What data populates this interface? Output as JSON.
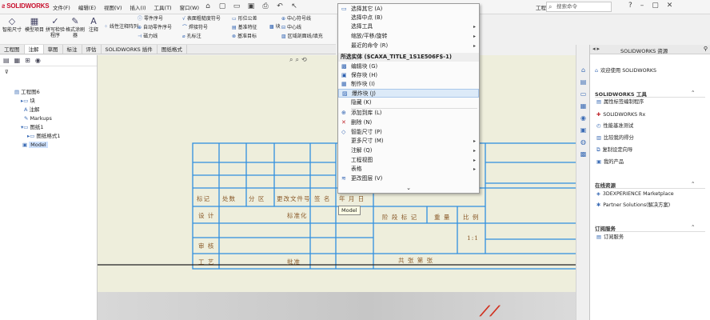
{
  "app": {
    "logo": "SOLIDWORKS",
    "menus": [
      "文件(F)",
      "编辑(E)",
      "视图(V)",
      "插入(I)",
      "工具(T)",
      "窗口(W)"
    ],
    "doc_title": "工程图6...",
    "search_placeholder": "搜索命令"
  },
  "ribbon": {
    "big_buttons": [
      {
        "label": "智能尺寸",
        "icon": "smart-dimension-icon"
      },
      {
        "label": "模型项目",
        "icon": "model-items-icon"
      },
      {
        "label": "拼写检验程序",
        "icon": "spell-check-icon"
      },
      {
        "label": "格式涂刷器",
        "icon": "format-painter-icon"
      },
      {
        "label": "注释",
        "icon": "note-icon"
      }
    ],
    "small_buttons": [
      {
        "label": "线性注释阵列",
        "icon": "linear-pattern-icon"
      },
      {
        "label": "零件序号",
        "icon": "balloon-icon"
      },
      {
        "label": "自动零件序号",
        "icon": "auto-balloon-icon"
      },
      {
        "label": "磁力线",
        "icon": "magnetic-line-icon"
      },
      {
        "label": "表面粗糙度符号",
        "icon": "surface-finish-icon"
      },
      {
        "label": "焊接符号",
        "icon": "weld-symbol-icon"
      },
      {
        "label": "孔标注",
        "icon": "hole-callout-icon"
      },
      {
        "label": "形位公差",
        "icon": "gtol-icon"
      },
      {
        "label": "基准特征",
        "icon": "datum-feature-icon"
      },
      {
        "label": "基准目标",
        "icon": "datum-target-icon"
      },
      {
        "label": "块",
        "icon": "block-icon"
      },
      {
        "label": "中心符号线",
        "icon": "center-mark-icon"
      },
      {
        "label": "中心线",
        "icon": "centerline-icon"
      },
      {
        "label": "区域剖面线/填充",
        "icon": "area-hatch-icon"
      }
    ]
  },
  "tabs": [
    "工程图",
    "注解",
    "草图",
    "标注",
    "评估",
    "SOLIDWORKS 插件",
    "图纸格式"
  ],
  "active_tab": 1,
  "tree": [
    {
      "label": "工程图6",
      "icon": "drawing-icon",
      "indent": 0
    },
    {
      "label": "块",
      "icon": "folder-icon",
      "indent": 1
    },
    {
      "label": "注解",
      "icon": "annotation-icon",
      "indent": 1
    },
    {
      "label": "Markups",
      "icon": "markup-icon",
      "indent": 1
    },
    {
      "label": "图纸1",
      "icon": "sheet-icon",
      "indent": 1
    },
    {
      "label": "图纸格式1",
      "icon": "sheet-format-icon",
      "indent": 2
    },
    {
      "label": "Model",
      "icon": "model-icon",
      "indent": 1
    }
  ],
  "title_block": {
    "cells": [
      "标记",
      "处数",
      "分 区",
      "更改文件号",
      "签 名",
      "年 月 日",
      "设 计",
      "标准化",
      "阶 段 标 记",
      "重 量",
      "比 例",
      "审 核",
      "1:1",
      "工 艺",
      "批准",
      "共 张 第 张"
    ]
  },
  "context_menu": {
    "top_items": [
      {
        "label": "选择其它 (A)",
        "icon": "select-other-icon",
        "submenu": false
      },
      {
        "label": "选择中点 (B)",
        "icon": "",
        "submenu": false
      },
      {
        "label": "选择工具",
        "icon": "",
        "submenu": true
      },
      {
        "label": "缩放/平移/旋转",
        "icon": "",
        "submenu": true
      },
      {
        "label": "最近的命令 (R)",
        "icon": "",
        "submenu": true
      }
    ],
    "section_header": "所选实体 ($CAXA_TITLE_1S1E506F$-1)",
    "section_items": [
      {
        "label": "编辑块 (G)",
        "icon": "edit-block-icon",
        "submenu": false
      },
      {
        "label": "保存块 (H)",
        "icon": "save-block-icon",
        "submenu": false
      },
      {
        "label": "制作块 (I)",
        "icon": "make-block-icon",
        "submenu": false
      },
      {
        "label": "爆炸块 (J)",
        "icon": "explode-block-icon",
        "submenu": false,
        "highlighted": true
      },
      {
        "label": "隐藏 (K)",
        "icon": "",
        "submenu": false
      },
      {
        "label": "添加到库 (L)",
        "icon": "add-to-library-icon",
        "submenu": false
      },
      {
        "label": "删除 (N)",
        "icon": "delete-icon",
        "submenu": false
      },
      {
        "label": "智能尺寸 (P)",
        "icon": "smart-dimension-icon",
        "submenu": false
      },
      {
        "label": "更多尺寸 (M)",
        "icon": "",
        "submenu": true
      },
      {
        "label": "注解 (Q)",
        "icon": "",
        "submenu": true
      },
      {
        "label": "工程视图",
        "icon": "",
        "submenu": true
      },
      {
        "label": "表格",
        "icon": "",
        "submenu": true
      },
      {
        "label": "更改图层 (V)",
        "icon": "change-layer-icon",
        "submenu": false
      }
    ],
    "more": "⌄"
  },
  "tooltip": "Model",
  "task_pane": {
    "title": "SOLIDWORKS 资源",
    "welcome": "欢迎使用 SOLIDWORKS",
    "sections": [
      {
        "title": "SOLIDWORKS 工具",
        "items": [
          "属性标签编制程序",
          "SOLIDWORKS Rx",
          "性能基准测试",
          "比较我的得分",
          "复制设定向导",
          "我的产品"
        ]
      },
      {
        "title": "在线资源",
        "items": [
          "3DEXPERIENCE Marketplace",
          "Partner Solutions(解决方案)"
        ]
      },
      {
        "title": "订阅服务",
        "items": [
          "订阅服务"
        ]
      }
    ]
  }
}
